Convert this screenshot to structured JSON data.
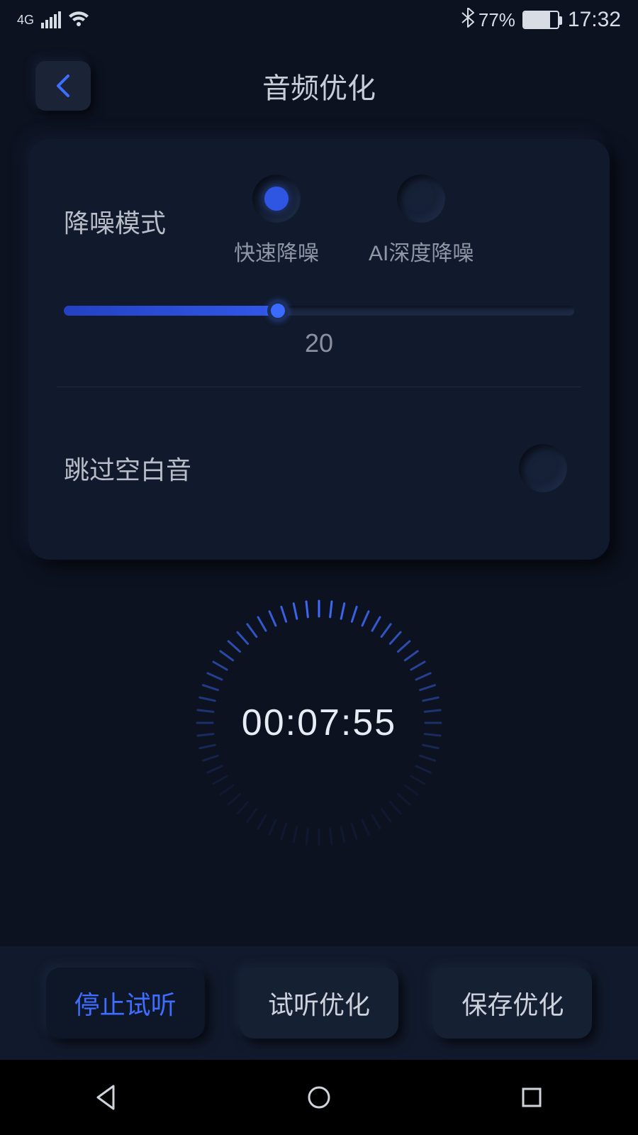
{
  "statusbar": {
    "network": "4G",
    "battery_percent": "77%",
    "time": "17:32"
  },
  "header": {
    "title": "音频优化"
  },
  "card": {
    "noise_label": "降噪模式",
    "radio_fast": "快速降噪",
    "radio_ai": "AI深度降噪",
    "slider_value": "20",
    "skip_silence": "跳过空白音"
  },
  "timer": {
    "display": "00:07:55"
  },
  "buttons": {
    "stop_preview": "停止试听",
    "preview_opt": "试听优化",
    "save_opt": "保存优化"
  }
}
